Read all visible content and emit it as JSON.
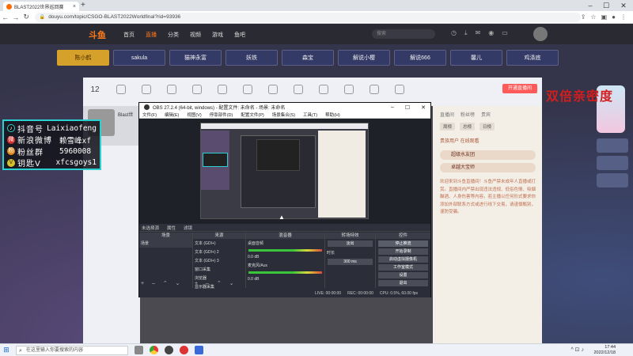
{
  "browser": {
    "tab_title": "BLAST2022世界巡回赛",
    "url": "douyu.com/topic/CSGO-BLAST2022Worldfinal?rid=93936",
    "new_tab": "+",
    "win_min": "–",
    "win_max": "☐",
    "win_close": "✕"
  },
  "site": {
    "logo": "斗鱼",
    "nav": [
      "首页",
      "直播",
      "分类",
      "视频",
      "游戏",
      "鱼吧"
    ],
    "search_placeholder": "搜索"
  },
  "teams": [
    "陈小鹤",
    "sakula",
    "猫神永富",
    "妖铁",
    "森宝",
    "解说小樱",
    "解说666",
    "馨儿",
    "鸡涤底"
  ],
  "panel": {
    "count": "12",
    "cta": "开通直播间",
    "streamer_name": "Blast世"
  },
  "side": {
    "tabs": [
      "直播间",
      "粉丝榜",
      "贵宾"
    ],
    "subtabs": [
      "周榜",
      "总榜",
      "日榜"
    ],
    "rank_line": "贵族用户 在线观看",
    "badge1": "超级水友团",
    "badge2": "卓越大宝师",
    "body": "欢迎来到斗鱼直播间！斗鱼严禁未成年人直播或打赏。直播间内严禁出现违法违规、低俗色情、吸烟酗酒、人身伤害等内容。若主播以任何形式要求你添加外部联系方式或进行线下交易，请谨慎甄别，谨防受骗。"
  },
  "overlay_label": "双倍亲密度",
  "social": [
    {
      "icon": "♪",
      "label": "抖音号",
      "value": "Laixiaofeng",
      "color": "#111111"
    },
    {
      "icon": "微",
      "label": "新浪微博",
      "value": "赖雪峰xf",
      "color": "#d8302f"
    },
    {
      "icon": "粉",
      "label": "粉丝群",
      "value": "5960008",
      "color": "#e08a1e"
    },
    {
      "icon": "V",
      "label": "钥匙V",
      "value": "xfcsgoys1",
      "color": "#d8c02a"
    }
  ],
  "obs": {
    "title": "OBS 27.2.4 (64-bit, windows) - 配置文件: 未命名 - 场景: 未命名",
    "menu": [
      "文件(F)",
      "编辑(E)",
      "视图(V)",
      "停靠部件(D)",
      "配置文件(P)",
      "场景集合(S)",
      "工具(T)",
      "帮助(H)"
    ],
    "scene_status": "未选择源",
    "scene_props": "属性",
    "scene_filters": "滤镜",
    "docks": {
      "scenes": "场景",
      "sources": "来源",
      "mixer": "混音器",
      "transitions": "转场特效",
      "controls": "控件"
    },
    "scene_item": "场景",
    "sources": [
      "文本 (GDI+)",
      "文本 (GDI+) 2",
      "文本 (GDI+) 3",
      "窗口采集",
      "浏览器",
      "显示器采集"
    ],
    "mixer_1": "桌面音频",
    "mixer_2": "麦克风/Aux",
    "mixer_db": "0.0 dB",
    "transition": "淡出",
    "duration_label": "时长",
    "duration": "300 ms",
    "controls": [
      "停止推流",
      "开始录制",
      "启动虚拟摄像机",
      "工作室模式",
      "设置",
      "退出"
    ],
    "status_live": "LIVE: 00:00:00",
    "status_rec": "REC: 00:00:00",
    "status_cpu": "CPU: 0.5%, 60.00 fps",
    "footer_buttons": "+ – ⌃ ⌄"
  },
  "taskbar": {
    "search_placeholder": "在这里输入你要搜索的内容",
    "time": "17:44",
    "date": "2022/12/18",
    "tray": "^ ⊡ ♪"
  }
}
